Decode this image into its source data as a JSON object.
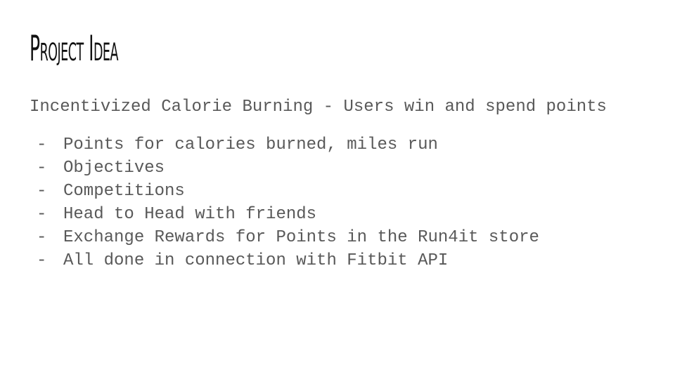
{
  "slide": {
    "title": "Project Idea",
    "subtitle": "Incentivized Calorie Burning - Users win and spend points",
    "bullet_marker": "-",
    "bullets": [
      "Points for calories burned, miles run",
      "Objectives",
      "Competitions",
      "Head to Head with friends",
      "Exchange Rewards for Points in the Run4it store",
      "All done in connection with Fitbit API"
    ],
    "colors": {
      "title": "#111111",
      "body": "#595959",
      "background": "#ffffff"
    }
  }
}
